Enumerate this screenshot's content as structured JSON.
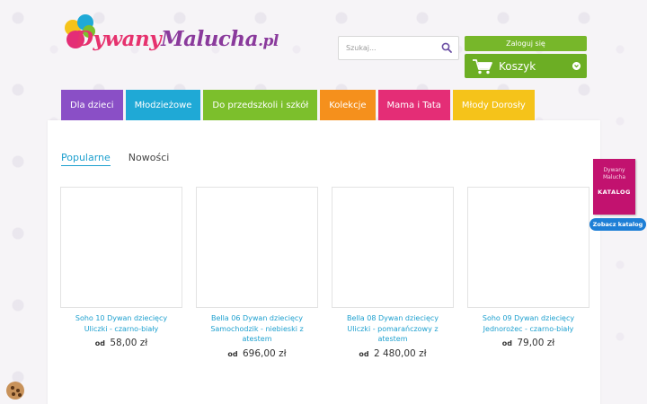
{
  "logo": {
    "part1": "Dywany",
    "part2": "Malucha",
    "part3": ".pl"
  },
  "search": {
    "placeholder": "Szukaj..."
  },
  "account": {
    "login_label": "Zaloguj się"
  },
  "cart": {
    "label": "Koszyk"
  },
  "nav": {
    "items": [
      {
        "label": "Dla dzieci",
        "color": "#8a4fc6"
      },
      {
        "label": "Młodzieżowe",
        "color": "#1fa9d6"
      },
      {
        "label": "Do przedszkoli i szkół",
        "color": "#7cbf2c"
      },
      {
        "label": "Kolekcje",
        "color": "#f5901c"
      },
      {
        "label": "Mama i Tata",
        "color": "#e42d76"
      },
      {
        "label": "Młody Dorosły",
        "color": "#f5c31a"
      }
    ]
  },
  "tabs": [
    {
      "label": "Popularne",
      "active": true
    },
    {
      "label": "Nowości",
      "active": false
    }
  ],
  "products": [
    {
      "name": "Soho 10 Dywan dziecięcy Uliczki - czarno-biały",
      "price_prefix": "od",
      "price": "58,00 zł"
    },
    {
      "name": "Bella 06 Dywan dziecięcy Samochodzik - niebieski z atestem",
      "price_prefix": "od",
      "price": "696,00 zł"
    },
    {
      "name": "Bella 08 Dywan dziecięcy Uliczki - pomarańczowy z atestem",
      "price_prefix": "od",
      "price": "2 480,00 zł"
    },
    {
      "name": "Soho 09 Dywan dziecięcy Jednorożec - czarno-biały",
      "price_prefix": "od",
      "price": "79,00 zł"
    }
  ],
  "catalog": {
    "brand_line1": "Dywany",
    "brand_line2": "Malucha",
    "title": "KATALOG",
    "button": "Zobacz katalog"
  },
  "colors": {
    "accent_blue": "#1ea0cf",
    "green": "#6cae24",
    "catalog": "#c2126f"
  }
}
